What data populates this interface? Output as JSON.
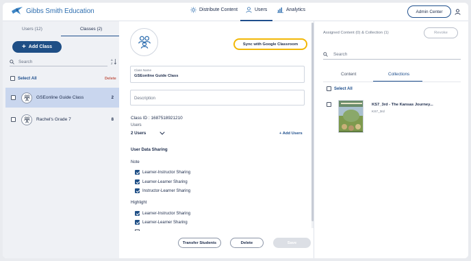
{
  "header": {
    "logo_text": "Gibbs Smith Education",
    "nav": [
      {
        "label": "Distribute Content",
        "icon": "sun-icon"
      },
      {
        "label": "Users",
        "icon": "user-icon",
        "active": true
      },
      {
        "label": "Analytics",
        "icon": "bar-chart-icon"
      }
    ],
    "admin_center_label": "Admin Center",
    "profile_icon": "user-icon"
  },
  "left": {
    "tabs": [
      {
        "label": "Users (12)",
        "active": false
      },
      {
        "label": "Classes (2)",
        "active": true
      }
    ],
    "add_class_label": "Add Class",
    "search_placeholder": "Search",
    "select_all_label": "Select All",
    "delete_label": "Delete",
    "classes": [
      {
        "name": "GSEonline Guide Class",
        "count": "2",
        "selected": true
      },
      {
        "name": "Rachel's Grade 7",
        "count": "8",
        "selected": false
      }
    ]
  },
  "middle": {
    "sync_label": "Sync with Google Classroom",
    "class_name_label": "Class Name",
    "class_name_value": "GSEonline Guide Class",
    "description_placeholder": "Description",
    "class_id_text": "Class ID : 1687518921210",
    "users_label": "Users",
    "users_selected": "2 Users",
    "add_users_label": "+ Add Users",
    "user_data_sharing_heading": "User Data Sharing",
    "note_heading": "Note",
    "note_options": [
      {
        "label": "Learner-Instructor Sharing",
        "checked": true
      },
      {
        "label": "Learner-Learner Sharing",
        "checked": true
      },
      {
        "label": "Instructor-Learner Sharing",
        "checked": true
      }
    ],
    "highlight_heading": "Highlight",
    "highlight_options": [
      {
        "label": "Learner-Instructor Sharing",
        "checked": true
      },
      {
        "label": "Learner-Learner Sharing",
        "checked": true
      }
    ],
    "transfer_label": "Transfer Students",
    "delete_label": "Delete",
    "save_label": "Save"
  },
  "right": {
    "assigned_text": "Assigned Content (0) & Collection (1)",
    "revoke_label": "Revoke",
    "search_placeholder": "Search",
    "tabs": [
      {
        "label": "Content",
        "active": false
      },
      {
        "label": "Collections",
        "active": true
      }
    ],
    "select_all_label": "Select All",
    "items": [
      {
        "title": "KS7_3rd - The Kansas Journey...",
        "subtitle": "KS7_3rd"
      }
    ]
  },
  "colors": {
    "brand_blue": "#1f4f86",
    "sync_border": "#f2b705",
    "selected_row": "#c9d6ee",
    "delete_red": "#c0584a"
  }
}
